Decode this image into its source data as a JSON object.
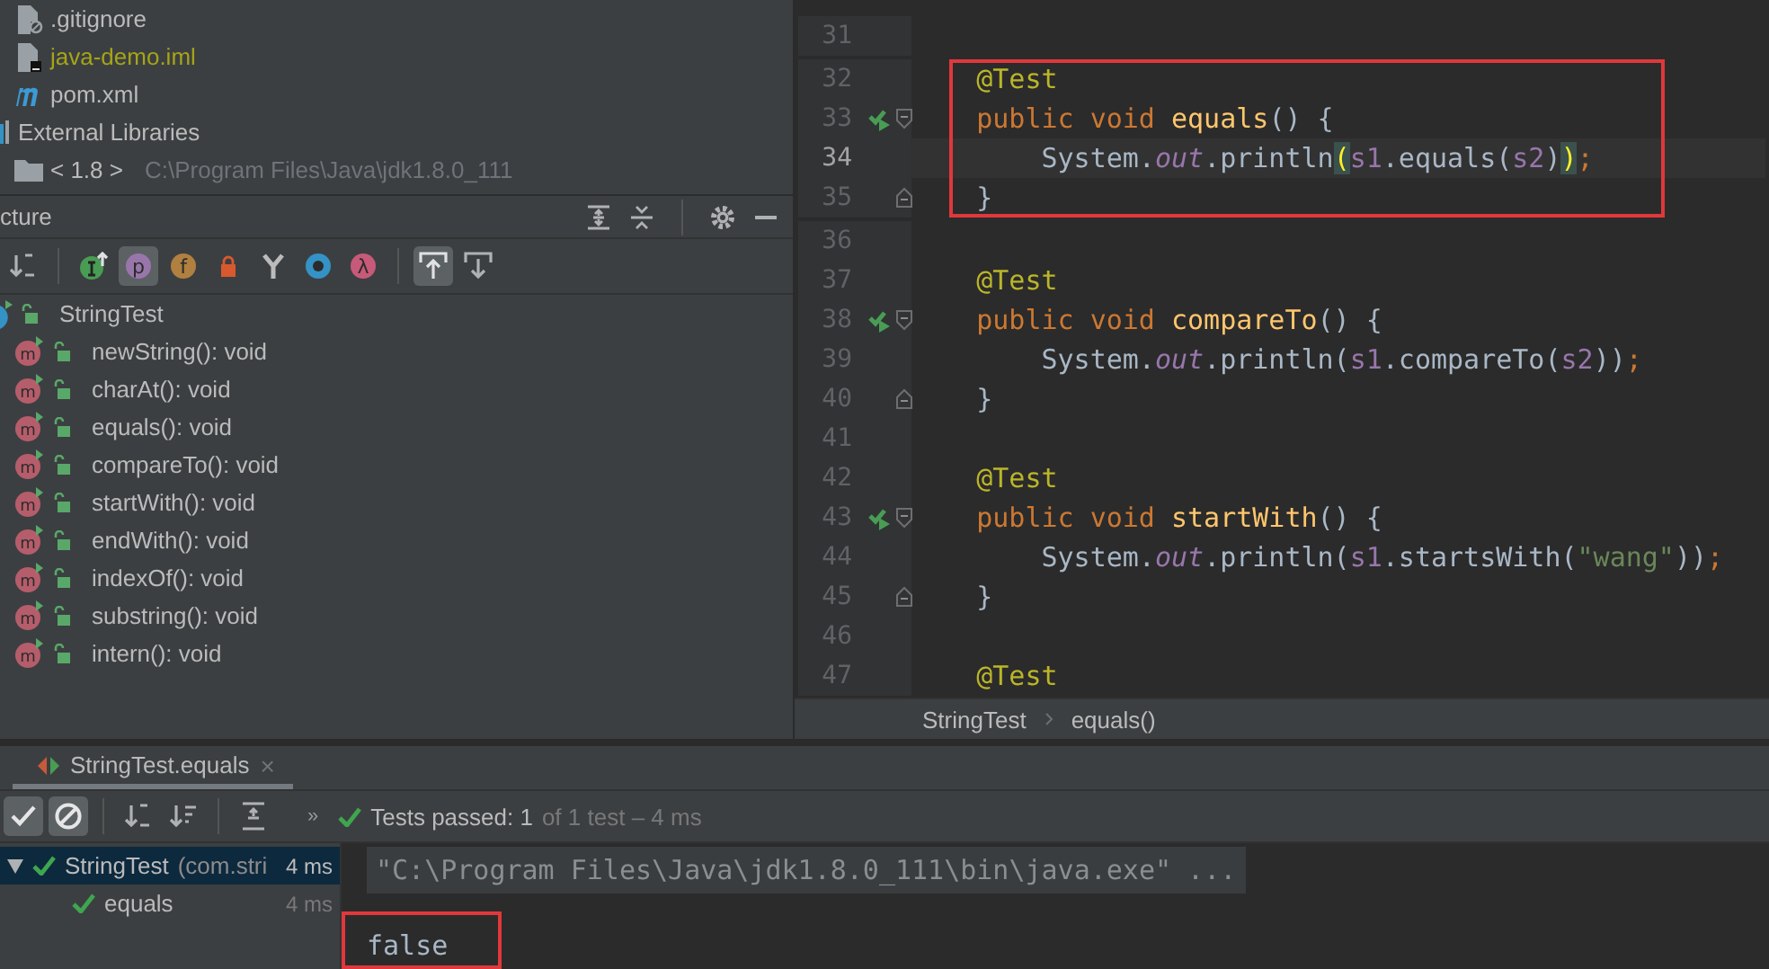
{
  "project_tree": {
    "items": [
      {
        "label": ".gitignore",
        "kind": "ignore-file",
        "color": "#bbbbbb"
      },
      {
        "label": "java-demo.iml",
        "kind": "module-file",
        "color": "#a5a518"
      },
      {
        "label": "pom.xml",
        "kind": "maven-file",
        "color": "#bbbbbb"
      },
      {
        "label": "External Libraries",
        "kind": "libraries",
        "color": "#bbbbbb"
      },
      {
        "label": "< 1.8 >",
        "path": "C:\\Program Files\\Java\\jdk1.8.0_111",
        "kind": "sdk",
        "color": "#bbbbbb"
      }
    ]
  },
  "structure": {
    "title": "cture",
    "toolbar": [
      {
        "kind": "sort",
        "selected": false
      },
      {
        "kind": "sep"
      },
      {
        "kind": "inherited",
        "selected": false
      },
      {
        "kind": "properties",
        "glyph": "p",
        "selected": true
      },
      {
        "kind": "fields",
        "glyph": "f",
        "selected": false
      },
      {
        "kind": "non-public",
        "selected": false
      },
      {
        "kind": "anonymous",
        "selected": false
      },
      {
        "kind": "members",
        "selected": false
      },
      {
        "kind": "lambdas",
        "glyph": "λ",
        "selected": false
      },
      {
        "kind": "sep"
      },
      {
        "kind": "scroll-to",
        "selected": true
      },
      {
        "kind": "scroll-from",
        "selected": false
      }
    ],
    "root": {
      "label": "StringTest",
      "children": [
        {
          "icon": "m",
          "label": "newString(): void"
        },
        {
          "icon": "m",
          "label": "charAt(): void"
        },
        {
          "icon": "m",
          "label": "equals(): void"
        },
        {
          "icon": "m",
          "label": "compareTo(): void"
        },
        {
          "icon": "m",
          "label": "startWith(): void"
        },
        {
          "icon": "m",
          "label": "endWith(): void"
        },
        {
          "icon": "m",
          "label": "indexOf(): void"
        },
        {
          "icon": "m",
          "label": "substring(): void"
        },
        {
          "icon": "m",
          "label": "intern(): void"
        }
      ]
    }
  },
  "editor": {
    "blocks": [
      {
        "lines": [
          {
            "number": "31"
          }
        ]
      },
      {
        "boxed": true,
        "lines": [
          {
            "number": "32",
            "tokens": [
              {
                "text": "    @Test",
                "kind": "ann"
              }
            ]
          },
          {
            "number": "33",
            "run": true,
            "fold_open": true,
            "tokens": [
              {
                "text": "    public void ",
                "kind": "kw"
              },
              {
                "text": "equals",
                "kind": "fn"
              },
              {
                "text": "() {",
                "kind": "plain"
              }
            ]
          },
          {
            "number": "34",
            "current": true,
            "tokens": [
              {
                "text": "        System.",
                "kind": "plain"
              },
              {
                "text": "out",
                "kind": "static"
              },
              {
                "text": ".println",
                "kind": "plain"
              },
              {
                "text": "(",
                "kind": "match"
              },
              {
                "text": "s1",
                "kind": "var"
              },
              {
                "text": ".equals(",
                "kind": "plain"
              },
              {
                "text": "s2",
                "kind": "var"
              },
              {
                "text": ")",
                "kind": "plain"
              },
              {
                "text": ")",
                "kind": "match"
              },
              {
                "text": ";",
                "kind": "kw"
              }
            ]
          },
          {
            "number": "35",
            "fold_close": true,
            "tokens": [
              {
                "text": "    }",
                "kind": "plain"
              }
            ]
          }
        ]
      },
      {
        "lines": [
          {
            "number": "36"
          },
          {
            "number": "37",
            "tokens": [
              {
                "text": "    @Test",
                "kind": "ann"
              }
            ]
          },
          {
            "number": "38",
            "run": true,
            "fold_open": true,
            "tokens": [
              {
                "text": "    public void ",
                "kind": "kw"
              },
              {
                "text": "compareTo",
                "kind": "fn"
              },
              {
                "text": "() {",
                "kind": "plain"
              }
            ]
          },
          {
            "number": "39",
            "tokens": [
              {
                "text": "        System.",
                "kind": "plain"
              },
              {
                "text": "out",
                "kind": "static"
              },
              {
                "text": ".println(",
                "kind": "plain"
              },
              {
                "text": "s1",
                "kind": "var"
              },
              {
                "text": ".compareTo(",
                "kind": "plain"
              },
              {
                "text": "s2",
                "kind": "var"
              },
              {
                "text": "))",
                "kind": "plain"
              },
              {
                "text": ";",
                "kind": "kw"
              }
            ]
          },
          {
            "number": "40",
            "fold_close": true,
            "tokens": [
              {
                "text": "    }",
                "kind": "plain"
              }
            ]
          },
          {
            "number": "41"
          },
          {
            "number": "42",
            "tokens": [
              {
                "text": "    @Test",
                "kind": "ann"
              }
            ]
          },
          {
            "number": "43",
            "run": true,
            "fold_open": true,
            "tokens": [
              {
                "text": "    public void ",
                "kind": "kw"
              },
              {
                "text": "startWith",
                "kind": "fn"
              },
              {
                "text": "() {",
                "kind": "plain"
              }
            ]
          },
          {
            "number": "44",
            "tokens": [
              {
                "text": "        System.",
                "kind": "plain"
              },
              {
                "text": "out",
                "kind": "static"
              },
              {
                "text": ".println(",
                "kind": "plain"
              },
              {
                "text": "s1",
                "kind": "var"
              },
              {
                "text": ".startsWith(",
                "kind": "plain"
              },
              {
                "text": "\"wang\"",
                "kind": "str"
              },
              {
                "text": "))",
                "kind": "plain"
              },
              {
                "text": ";",
                "kind": "kw"
              }
            ]
          },
          {
            "number": "45",
            "fold_close": true,
            "tokens": [
              {
                "text": "    }",
                "kind": "plain"
              }
            ]
          },
          {
            "number": "46"
          },
          {
            "number": "47",
            "tokens": [
              {
                "text": "    @Test",
                "kind": "ann"
              }
            ]
          }
        ]
      }
    ],
    "breadcrumbs": [
      "StringTest",
      "equals()"
    ]
  },
  "run_panel": {
    "tab": {
      "label": "StringTest.equals",
      "close": "×",
      "selected": true
    },
    "toolbar": [
      {
        "kind": "show-passed",
        "selected": true
      },
      {
        "kind": "show-ignored",
        "selected": true
      },
      {
        "kind": "sep"
      },
      {
        "kind": "sort-alpha",
        "selected": false
      },
      {
        "kind": "sort-duration",
        "selected": false
      },
      {
        "kind": "sep"
      },
      {
        "kind": "expand",
        "selected": false
      }
    ],
    "status": {
      "more": "»",
      "passed": "Tests passed: 1",
      "detail": "of 1 test – 4 ms"
    },
    "tests": [
      {
        "label": "StringTest",
        "package": "(com.stri",
        "time": "4 ms",
        "selected": true,
        "expanded": true,
        "children": [
          {
            "label": "equals",
            "time": "4 ms",
            "selected": false
          }
        ]
      }
    ],
    "console": [
      {
        "text": "\"C:\\Program Files\\Java\\jdk1.8.0_111\\bin\\java.exe\" ...",
        "kind": "command"
      },
      {
        "text": "false",
        "kind": "output",
        "boxed": true
      }
    ]
  }
}
